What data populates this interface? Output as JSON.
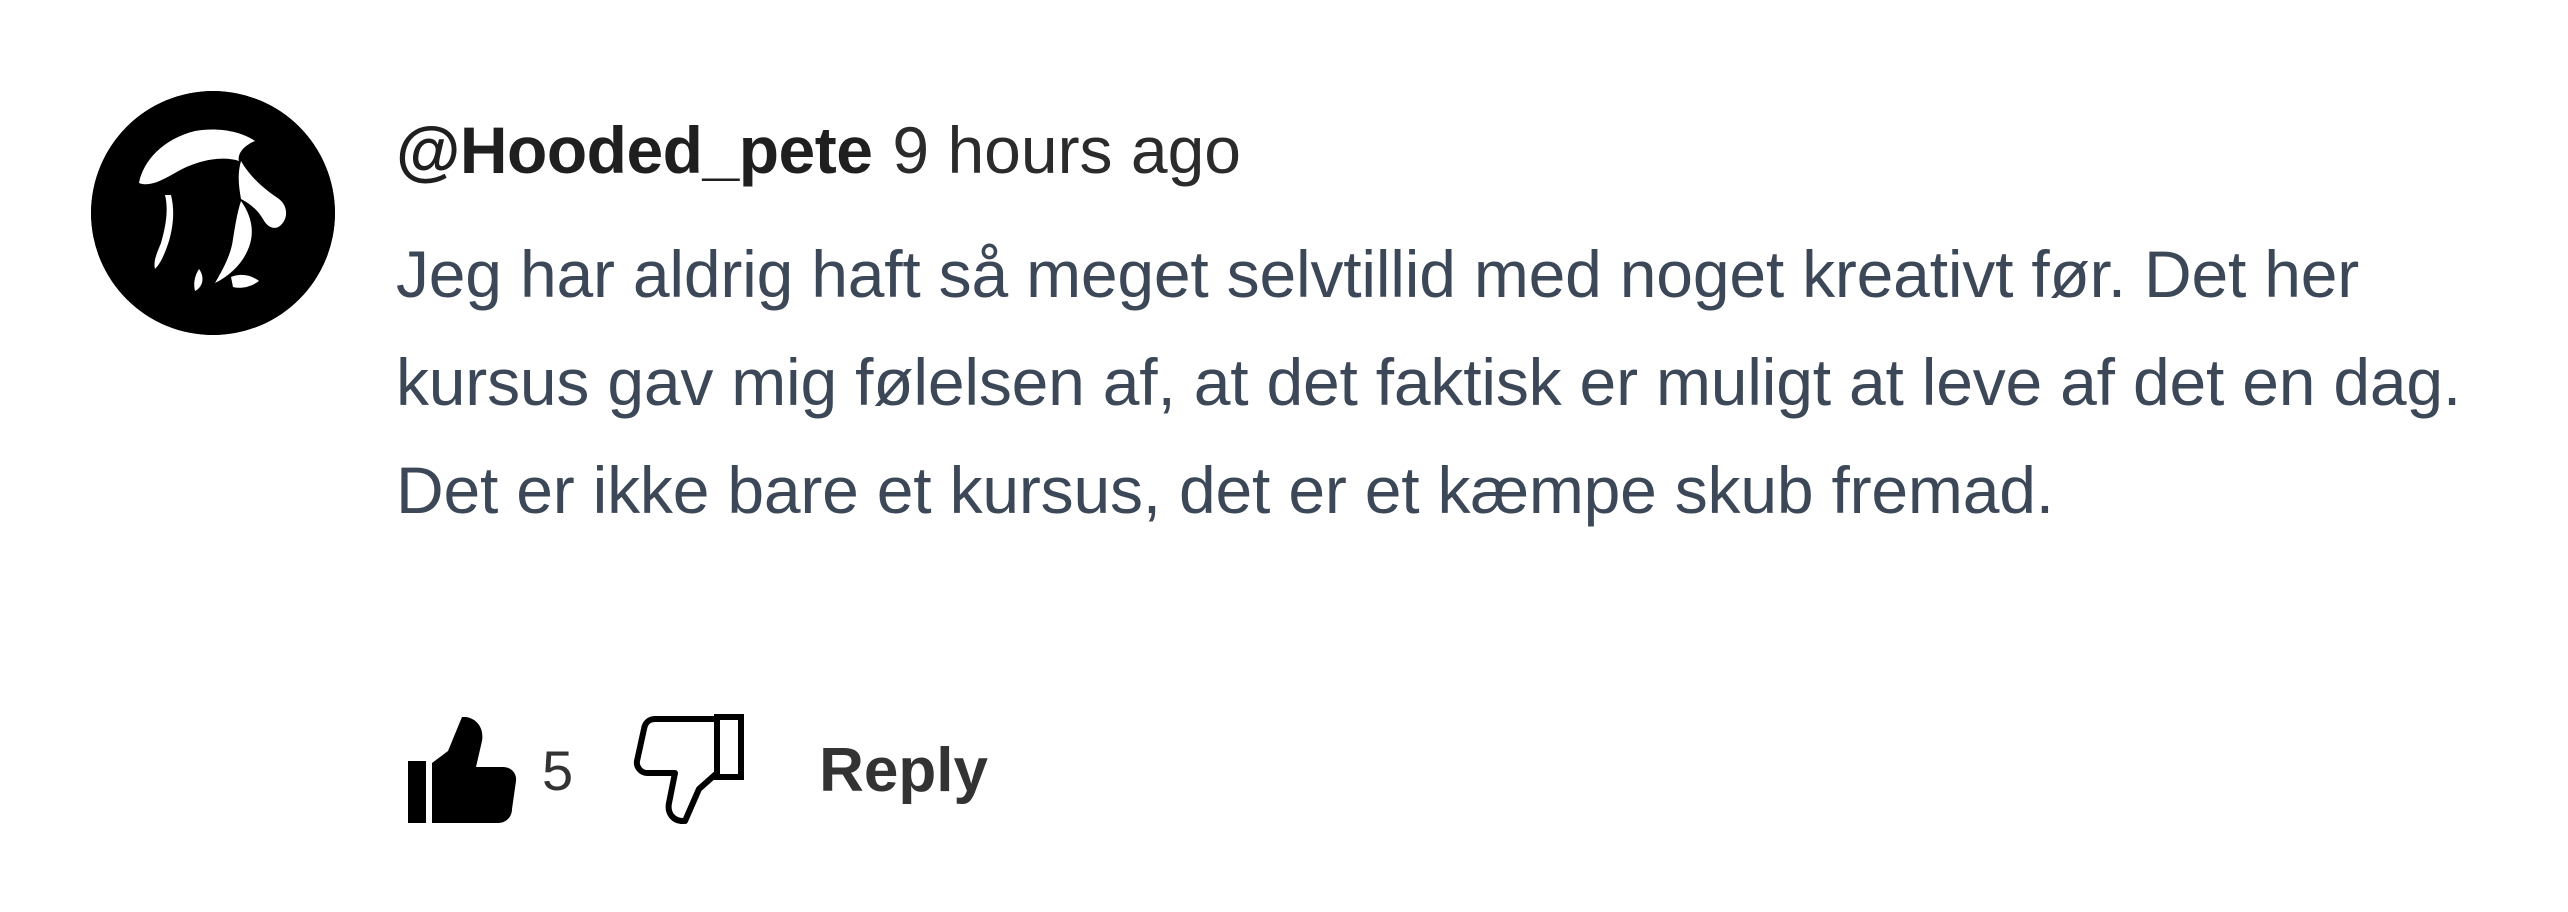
{
  "comment": {
    "author": "@Hooded_pete",
    "timestamp": "9 hours ago",
    "text": "Jeg har aldrig haft så meget selvtillid med noget kreativt før. Det her kursus gav mig følelsen af, at det faktisk er muligt at leve af det en dag. Det er ikke bare et kursus, det er et kæmpe skub fremad.",
    "avatar_icon": "hooded-figure-avatar",
    "actions": {
      "like_icon": "thumbs-up-icon",
      "like_count": "5",
      "dislike_icon": "thumbs-down-icon",
      "reply_label": "Reply"
    }
  },
  "colors": {
    "author": "#1f1f1f",
    "text": "#3c4858",
    "avatar_bg": "#000000"
  }
}
